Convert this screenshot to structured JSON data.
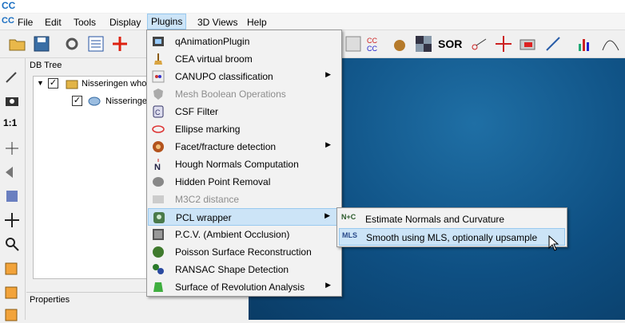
{
  "titlebar": {
    "logo": "CC"
  },
  "menubar": {
    "app_icon": "CC",
    "items": [
      {
        "label": "File"
      },
      {
        "label": "Edit"
      },
      {
        "label": "Tools"
      },
      {
        "label": "Display"
      },
      {
        "label": "Plugins"
      },
      {
        "label": "3D Views"
      },
      {
        "label": "Help"
      }
    ]
  },
  "toolbar": {
    "sor_label": "SOR"
  },
  "left_toolbar": {
    "one_to_one": "1:1"
  },
  "db_tree": {
    "title": "DB Tree",
    "items": [
      {
        "label": "Nisseringen who"
      },
      {
        "label": "Nisseringen"
      }
    ]
  },
  "properties": {
    "title": "Properties"
  },
  "plugins_menu": {
    "items": [
      {
        "label": "qAnimationPlugin",
        "icon": "film-icon"
      },
      {
        "label": "CEA virtual broom",
        "icon": "broom-icon"
      },
      {
        "label": "CANUPO classification",
        "icon": "canupo-icon",
        "submenu": true
      },
      {
        "label": "Mesh Boolean Operations",
        "icon": "shield-icon",
        "disabled": true
      },
      {
        "label": "CSF Filter",
        "icon": "csf-icon"
      },
      {
        "label": "Ellipse marking",
        "icon": "ellipse-icon"
      },
      {
        "label": "Facet/fracture detection",
        "icon": "facet-icon",
        "submenu": true
      },
      {
        "label": "Hough Normals Computation",
        "icon": "normal-arrow-icon"
      },
      {
        "label": "Hidden Point Removal",
        "icon": "hidden-point-icon"
      },
      {
        "label": "M3C2 distance",
        "icon": "m3c2-icon",
        "disabled": true
      },
      {
        "label": "PCL wrapper",
        "icon": "pcl-icon",
        "submenu": true,
        "highlighted": true
      },
      {
        "label": "P.C.V. (Ambient Occlusion)",
        "icon": "pcv-icon"
      },
      {
        "label": "Poisson Surface Reconstruction",
        "icon": "poisson-icon"
      },
      {
        "label": "RANSAC Shape Detection",
        "icon": "ransac-icon"
      },
      {
        "label": "Surface of Revolution Analysis",
        "icon": "revolution-icon",
        "submenu": true
      }
    ]
  },
  "pcl_submenu": {
    "items": [
      {
        "label": "Estimate Normals and Curvature",
        "icon_text": "N+C"
      },
      {
        "label": "Smooth using MLS, optionally upsample",
        "icon_text": "MLS",
        "highlighted": true
      }
    ]
  },
  "colors": {
    "menu_highlight": "#cce4f7",
    "menu_highlight_border": "#99c9ef",
    "viewport_blue": "#0e4f82",
    "disabled_text": "#8d8d8d"
  }
}
